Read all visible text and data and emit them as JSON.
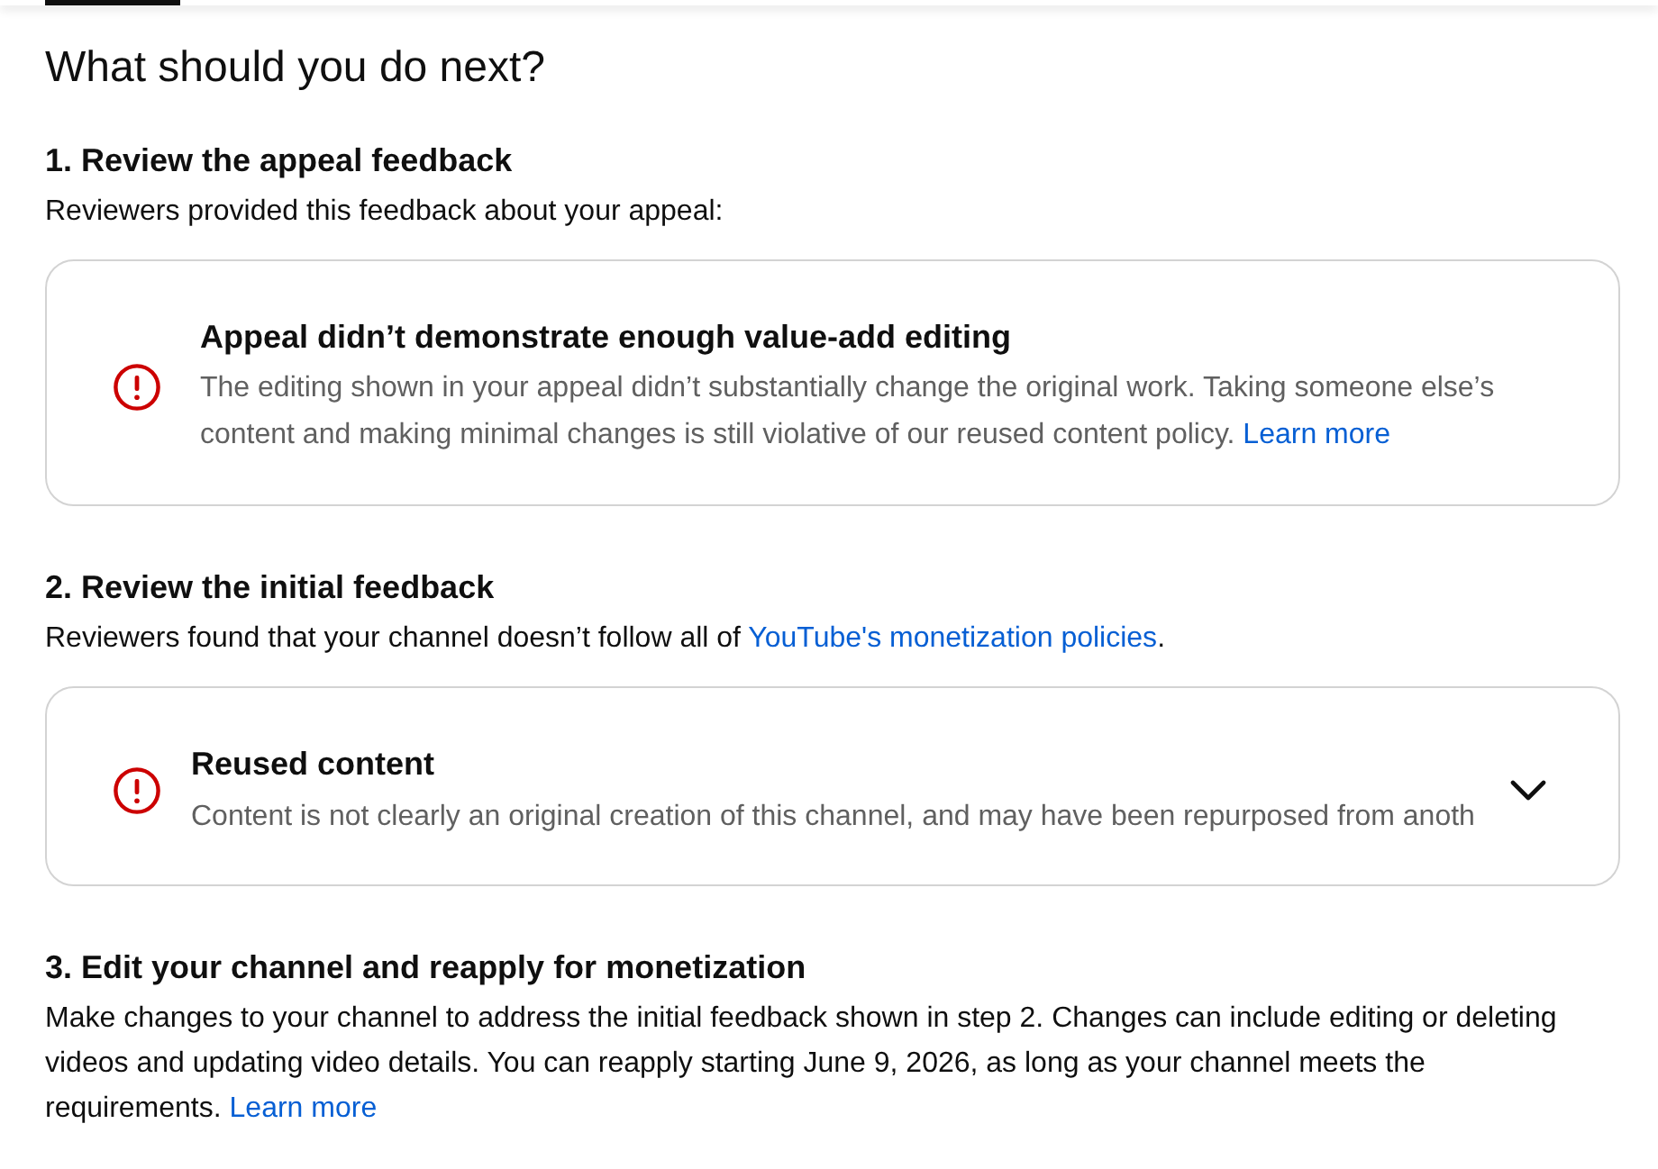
{
  "heading": "What should you do next?",
  "steps": [
    {
      "title": "1. Review the appeal feedback",
      "description": [
        {
          "kind": "text",
          "text": "Reviewers provided this feedback about your appeal:"
        }
      ],
      "card": {
        "kind": "static",
        "title": "Appeal didn’t demonstrate enough value-add editing",
        "body": [
          {
            "kind": "text",
            "text": "The editing shown in your appeal didn’t substantially change the original work. Taking someone else’s content and making minimal changes is still violative of our reused content policy. "
          },
          {
            "kind": "link",
            "text": "Learn more"
          }
        ]
      }
    },
    {
      "title": "2. Review the initial feedback",
      "description": [
        {
          "kind": "text",
          "text": "Reviewers found that your channel doesn’t follow all of "
        },
        {
          "kind": "link",
          "text": "YouTube's monetization policies"
        },
        {
          "kind": "text",
          "text": "."
        }
      ],
      "card": {
        "kind": "expandable",
        "expanded": false,
        "title": "Reused content",
        "body": [
          {
            "kind": "text",
            "text": "Content is not clearly an original creation of this channel, and may have been repurposed from anoth"
          }
        ]
      }
    },
    {
      "title": "3. Edit your channel and reapply for monetization",
      "description": [
        {
          "kind": "text",
          "text": "Make changes to your channel to address the initial feedback shown in step 2. Changes can include editing or deleting videos and updating video details. You can reapply starting June 9, 2026, as long as your channel meets the requirements. "
        },
        {
          "kind": "link",
          "text": "Learn more"
        }
      ]
    }
  ]
}
